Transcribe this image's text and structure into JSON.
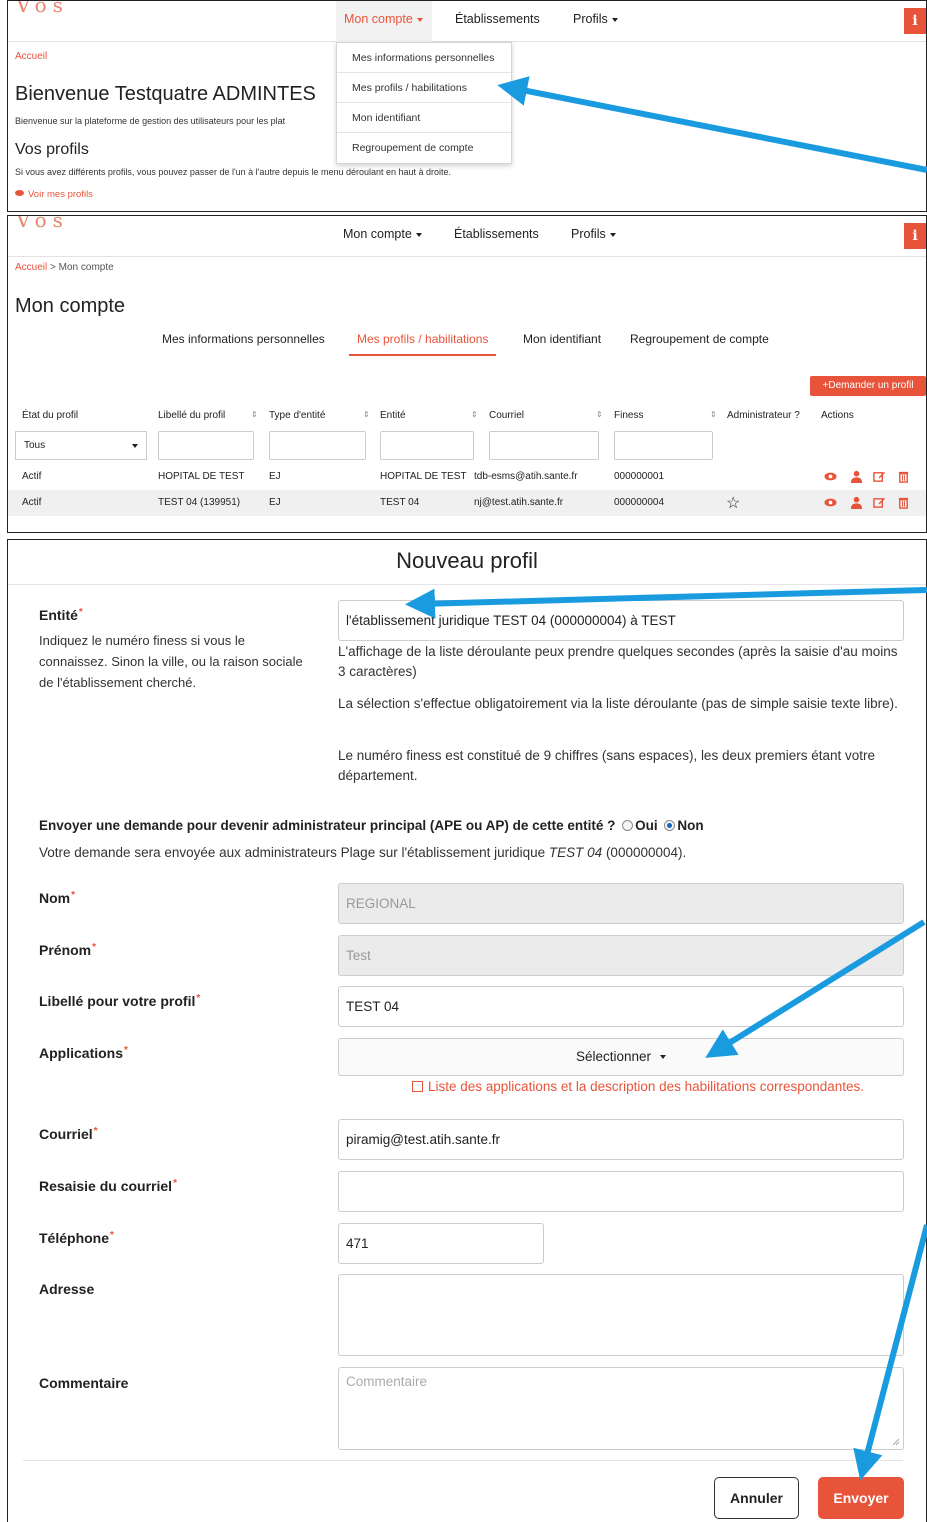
{
  "nav": {
    "logo": "Vos",
    "mon_compte": "Mon compte",
    "etablissements": "Établissements",
    "profils": "Profils",
    "info": "i"
  },
  "accent_color": "#e8543a",
  "arrow_color": "#1a9be0",
  "panel1": {
    "breadcrumb": "Accueil",
    "welcome_title": "Bienvenue Testquatre ADMINTES",
    "welcome_sub": "Bienvenue sur la plateforme de gestion des utilisateurs pour les plat",
    "profils_title": "Vos profils",
    "profils_sub": "Si vous avez différents profils, vous pouvez passer de l'un à l'autre depuis le menu déroulant en haut à droite.",
    "voir_link": "Voir mes profils",
    "dropdown": [
      "Mes informations personnelles",
      "Mes profils / habilitations",
      "Mon identifiant",
      "Regroupement de compte"
    ]
  },
  "panel2": {
    "breadcrumb_home": "Accueil",
    "breadcrumb_sep": ">",
    "breadcrumb_current": "Mon compte",
    "title": "Mon compte",
    "tabs": [
      "Mes informations personnelles",
      "Mes profils / habilitations",
      "Mon identifiant",
      "Regroupement de compte"
    ],
    "demander_btn": "Demander un profil",
    "columns": [
      "État du profil",
      "Libellé du profil",
      "Type d'entité",
      "Entité",
      "Courriel",
      "Finess",
      "Administrateur ?",
      "Actions"
    ],
    "filter_select": "Tous",
    "rows": [
      {
        "etat": "Actif",
        "libelle": "HOPITAL DE TEST",
        "type": "EJ",
        "entite": "HOPITAL DE TEST",
        "courriel": "tdb-esms@atih.sante.fr",
        "finess": "000000001"
      },
      {
        "etat": "Actif",
        "libelle": "TEST 04 (139951)",
        "type": "EJ",
        "entite": "TEST 04",
        "courriel": "nj@test.atih.sante.fr",
        "finess": "000000004",
        "admin": "☆"
      }
    ]
  },
  "panel3": {
    "title": "Nouveau profil",
    "entite_label": "Entité",
    "entite_hint": "Indiquez le numéro finess si vous le connaissez. Sinon la ville, ou la raison sociale de l'établissement cherché.",
    "entite_value": "l'établissement juridique TEST 04 (000000004) à TEST",
    "help1": "L'affichage de la liste déroulante peux prendre quelques secondes (après la saisie d'au moins 3 caractères)",
    "help2": "La sélection s'effectue obligatoirement via la liste déroulante (pas de simple saisie texte libre).",
    "help3": "Le numéro finess est constitué de 9 chiffres (sans espaces), les deux premiers étant votre département.",
    "question": "Envoyer une demande pour devenir administrateur principal (APE ou AP) de cette entité ?",
    "oui": "Oui",
    "non": "Non",
    "q_note_prefix": "Votre demande sera envoyée aux administrateurs Plage sur l'établissement juridique",
    "q_note_entity": "TEST 04",
    "q_note_suffix": "(000000004).",
    "nom_label": "Nom",
    "nom_value": "REGIONAL",
    "prenom_label": "Prénom",
    "prenom_value": "Test",
    "libelle_label": "Libellé pour votre profil",
    "libelle_value": "TEST 04",
    "applications_label": "Applications",
    "applications_select": "Sélectionner",
    "apps_link": "Liste des applications et la description des habilitations correspondantes.",
    "courriel_label": "Courriel",
    "courriel_value": "piramig@test.atih.sante.fr",
    "resaisie_label": "Resaisie du courriel",
    "resaisie_value": "",
    "telephone_label": "Téléphone",
    "telephone_value": "471",
    "adresse_label": "Adresse",
    "adresse_value": "",
    "commentaire_label": "Commentaire",
    "commentaire_placeholder": "Commentaire",
    "annuler": "Annuler",
    "envoyer": "Envoyer"
  }
}
